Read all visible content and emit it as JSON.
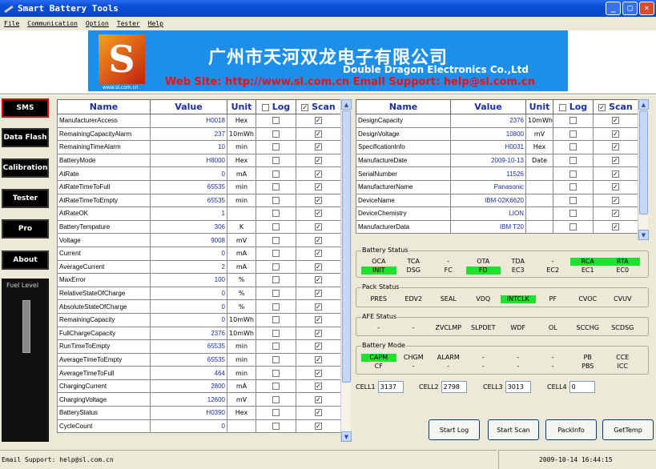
{
  "window": {
    "title": "Smart Battery Tools"
  },
  "menu": [
    "File",
    "Communication",
    "Option",
    "Tester",
    "Help"
  ],
  "banner": {
    "logo_letter": "S",
    "logo_url": "www.sl.com.cn",
    "chinese": "广州市天河双龙电子有限公司",
    "english": "Double Dragon Electronics Co.,Ltd",
    "web": "Web Site: http://www.sl.com.cn  Email Support: help@sl.com.cn"
  },
  "sidebar": [
    "SMS",
    "Data Flash",
    "Calibration",
    "Tester",
    "Pro",
    "About"
  ],
  "fuel_label": "Fuel Level",
  "headers": {
    "name": "Name",
    "value": "Value",
    "unit": "Unit",
    "log": "Log",
    "scan": "Scan"
  },
  "left_rows": [
    {
      "name": "ManufacturerAccess",
      "value": "H0018",
      "unit": "Hex",
      "log": false,
      "scan": true
    },
    {
      "name": "RemainingCapacityAlarm",
      "value": "237",
      "unit": "10mWh",
      "log": false,
      "scan": true
    },
    {
      "name": "RemainingTimeAlarm",
      "value": "10",
      "unit": "min",
      "log": false,
      "scan": true
    },
    {
      "name": "BatteryMode",
      "value": "H8000",
      "unit": "Hex",
      "log": false,
      "scan": true
    },
    {
      "name": "AtRate",
      "value": "0",
      "unit": "mA",
      "log": false,
      "scan": true
    },
    {
      "name": "AtRateTimeToFull",
      "value": "65535",
      "unit": "min",
      "log": false,
      "scan": true
    },
    {
      "name": "AtRateTimeToEmpty",
      "value": "65535",
      "unit": "min",
      "log": false,
      "scan": true
    },
    {
      "name": "AtRateOK",
      "value": "1",
      "unit": "",
      "log": false,
      "scan": true
    },
    {
      "name": "BatteryTempature",
      "value": "306",
      "unit": "K",
      "log": false,
      "scan": true
    },
    {
      "name": "Voltage",
      "value": "9008",
      "unit": "mV",
      "log": false,
      "scan": true
    },
    {
      "name": "Current",
      "value": "0",
      "unit": "mA",
      "log": false,
      "scan": true
    },
    {
      "name": "AverageCurrent",
      "value": "2",
      "unit": "mA",
      "log": false,
      "scan": true
    },
    {
      "name": "MaxError",
      "value": "100",
      "unit": "%",
      "log": false,
      "scan": true
    },
    {
      "name": "RelativeStateOfCharge",
      "value": "0",
      "unit": "%",
      "log": false,
      "scan": true
    },
    {
      "name": "AbsoluteStateOfCharge",
      "value": "0",
      "unit": "%",
      "log": false,
      "scan": true
    },
    {
      "name": "RemainingCapacity",
      "value": "0",
      "unit": "10mWh",
      "log": false,
      "scan": true
    },
    {
      "name": "FullChargeCapacity",
      "value": "2376",
      "unit": "10mWh",
      "log": false,
      "scan": true
    },
    {
      "name": "RunTimeToEmpty",
      "value": "65535",
      "unit": "min",
      "log": false,
      "scan": true
    },
    {
      "name": "AverageTimeToEmpty",
      "value": "65535",
      "unit": "min",
      "log": false,
      "scan": true
    },
    {
      "name": "AverageTimeToFull",
      "value": "464",
      "unit": "min",
      "log": false,
      "scan": true
    },
    {
      "name": "ChargingCurrent",
      "value": "2800",
      "unit": "mA",
      "log": false,
      "scan": true
    },
    {
      "name": "ChargingVoltage",
      "value": "12600",
      "unit": "mV",
      "log": false,
      "scan": true
    },
    {
      "name": "BatteryStatus",
      "value": "H0390",
      "unit": "Hex",
      "log": false,
      "scan": true
    },
    {
      "name": "CycleCount",
      "value": "0",
      "unit": "",
      "log": false,
      "scan": true
    }
  ],
  "right_rows": [
    {
      "name": "DesignCapacity",
      "value": "2376",
      "unit": "10mWh",
      "log": false,
      "scan": true
    },
    {
      "name": "DesignVoltage",
      "value": "10800",
      "unit": "mV",
      "log": false,
      "scan": true
    },
    {
      "name": "SpecificationInfo",
      "value": "H0031",
      "unit": "Hex",
      "log": false,
      "scan": true
    },
    {
      "name": "ManufactureDate",
      "value": "2009-10-13",
      "unit": "Date",
      "log": false,
      "scan": true
    },
    {
      "name": "SerialNumber",
      "value": "11526",
      "unit": "",
      "log": false,
      "scan": true
    },
    {
      "name": "ManufacturerName",
      "value": "Panasonic",
      "unit": "",
      "log": false,
      "scan": true
    },
    {
      "name": "DeviceName",
      "value": "IBM-02K6620",
      "unit": "",
      "log": false,
      "scan": true
    },
    {
      "name": "DeviceChemistry",
      "value": "LION",
      "unit": "",
      "log": false,
      "scan": true
    },
    {
      "name": "ManufacturerData",
      "value": "IBM T20",
      "unit": "",
      "log": false,
      "scan": true
    }
  ],
  "groups": [
    {
      "title": "Battery Status",
      "rows": [
        [
          {
            "t": "OCA",
            "g": false
          },
          {
            "t": "TCA",
            "g": false
          },
          {
            "t": "-",
            "g": false
          },
          {
            "t": "OTA",
            "g": false
          },
          {
            "t": "TDA",
            "g": false
          },
          {
            "t": "-",
            "g": false
          },
          {
            "t": "RCA",
            "g": true
          },
          {
            "t": "RTA",
            "g": true
          }
        ],
        [
          {
            "t": "INIT",
            "g": true
          },
          {
            "t": "DSG",
            "g": false
          },
          {
            "t": "FC",
            "g": false
          },
          {
            "t": "FD",
            "g": true
          },
          {
            "t": "EC3",
            "g": false
          },
          {
            "t": "EC2",
            "g": false
          },
          {
            "t": "EC1",
            "g": false
          },
          {
            "t": "EC0",
            "g": false
          }
        ]
      ]
    },
    {
      "title": "Pack Status",
      "rows": [
        [
          {
            "t": "PRES",
            "g": false
          },
          {
            "t": "EDV2",
            "g": false
          },
          {
            "t": "SEAL",
            "g": false
          },
          {
            "t": "VDQ",
            "g": false
          },
          {
            "t": "INTCLK",
            "g": true
          },
          {
            "t": "PF",
            "g": false
          },
          {
            "t": "CVOC",
            "g": false
          },
          {
            "t": "CVUV",
            "g": false
          }
        ]
      ]
    },
    {
      "title": "AFE Status",
      "rows": [
        [
          {
            "t": "-",
            "g": false
          },
          {
            "t": "-",
            "g": false
          },
          {
            "t": "ZVCLMP",
            "g": false
          },
          {
            "t": "SLPDET",
            "g": false
          },
          {
            "t": "WDF",
            "g": false
          },
          {
            "t": "OL",
            "g": false
          },
          {
            "t": "SCCHG",
            "g": false
          },
          {
            "t": "SCDSG",
            "g": false
          }
        ]
      ]
    },
    {
      "title": "Battery Mode",
      "rows": [
        [
          {
            "t": "CAPM",
            "g": true
          },
          {
            "t": "CHGM",
            "g": false
          },
          {
            "t": "ALARM",
            "g": false
          },
          {
            "t": "-",
            "g": false
          },
          {
            "t": "-",
            "g": false
          },
          {
            "t": "-",
            "g": false
          },
          {
            "t": "PB",
            "g": false
          },
          {
            "t": "CCE",
            "g": false
          }
        ],
        [
          {
            "t": "CF",
            "g": false
          },
          {
            "t": "-",
            "g": false
          },
          {
            "t": "-",
            "g": false
          },
          {
            "t": "-",
            "g": false
          },
          {
            "t": "-",
            "g": false
          },
          {
            "t": "-",
            "g": false
          },
          {
            "t": "PBS",
            "g": false
          },
          {
            "t": "ICC",
            "g": false
          }
        ]
      ]
    }
  ],
  "cells": [
    {
      "label": "CELL1",
      "value": "3137"
    },
    {
      "label": "CELL2",
      "value": "2798"
    },
    {
      "label": "CELL3",
      "value": "3013"
    },
    {
      "label": "CELL4",
      "value": "0"
    }
  ],
  "buttons": [
    "Start Log",
    "Start Scan",
    "PackInfo",
    "GetTemp"
  ],
  "status": {
    "left": "Email Support: help@sl.com.cn",
    "right": "2009-10-14 16:44:15"
  }
}
